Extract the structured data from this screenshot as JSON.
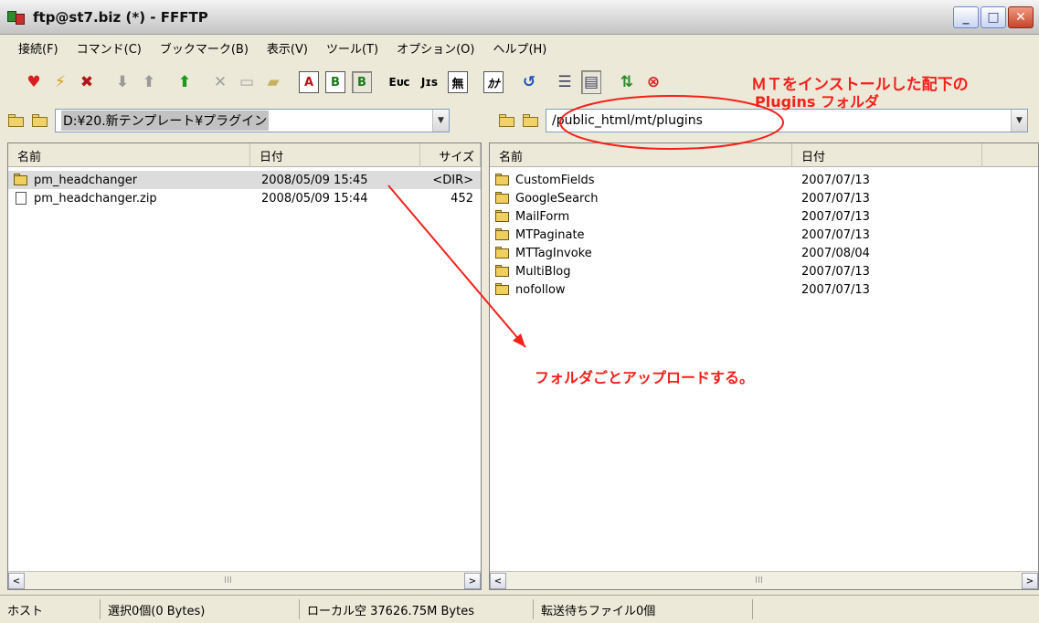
{
  "window": {
    "title": "ftp@st7.biz (*) - FFFTP",
    "minimize_label": "_",
    "maximize_label": "□",
    "close_label": "✕"
  },
  "menu": {
    "items": [
      "接続(F)",
      "コマンド(C)",
      "ブックマーク(B)",
      "表示(V)",
      "ツール(T)",
      "オプション(O)",
      "ヘルプ(H)"
    ]
  },
  "toolbar": {
    "connect_glyph": "♥",
    "quick_connect_glyph": "⚡",
    "disconnect_glyph": "✖",
    "download_glyph": "⬇",
    "upload_glyph": "⬆",
    "mirror_upload_glyph": "⬆",
    "delete_glyph": "✕",
    "rename_glyph": "▭",
    "mkdir_glyph": "▰",
    "ascii_glyph": "A",
    "binary_glyph": "B",
    "auto_glyph": "B",
    "euc_glyph": "Eᴜᴄ",
    "jis_glyph": "Jɪs",
    "nocode_glyph": "無",
    "kana_glyph": "ｶﾅ",
    "refresh_glyph": "↺",
    "list_glyph": "☰",
    "details_glyph": "▤",
    "sync_glyph": "⇅",
    "stop_glyph": "⊗"
  },
  "local": {
    "path": "D:¥20.新テンプレート¥プラグイン",
    "columns": {
      "name": "名前",
      "date": "日付",
      "size": "サイズ"
    },
    "rows": [
      {
        "name": "pm_headchanger",
        "date": "2008/05/09 15:45",
        "size": "<DIR>",
        "type": "folder"
      },
      {
        "name": "pm_headchanger.zip",
        "date": "2008/05/09 15:44",
        "size": "452",
        "type": "file"
      }
    ]
  },
  "remote": {
    "path": "/public_html/mt/plugins",
    "columns": {
      "name": "名前",
      "date": "日付"
    },
    "rows": [
      {
        "name": "CustomFields",
        "date": "2007/07/13",
        "type": "folder"
      },
      {
        "name": "GoogleSearch",
        "date": "2007/07/13",
        "type": "folder"
      },
      {
        "name": "MailForm",
        "date": "2007/07/13",
        "type": "folder"
      },
      {
        "name": "MTPaginate",
        "date": "2007/07/13",
        "type": "folder"
      },
      {
        "name": "MTTagInvoke",
        "date": "2007/08/04",
        "type": "folder"
      },
      {
        "name": "MultiBlog",
        "date": "2007/07/13",
        "type": "folder"
      },
      {
        "name": "nofollow",
        "date": "2007/07/13",
        "type": "folder"
      }
    ]
  },
  "status": {
    "host": "ホスト",
    "selection": "選択0個(0 Bytes)",
    "local_free": "ローカル空 37626.75M Bytes",
    "queue": "転送待ちファイル0個"
  },
  "annotations": {
    "top_line1": "ＭＴをインストールした配下の",
    "top_line2": "Plugins フォルダ",
    "middle": "フォルダごとアップロードする。",
    "color": "#f4201a"
  },
  "scroll": {
    "left_arrow": "<",
    "right_arrow": ">",
    "grip": "III"
  }
}
